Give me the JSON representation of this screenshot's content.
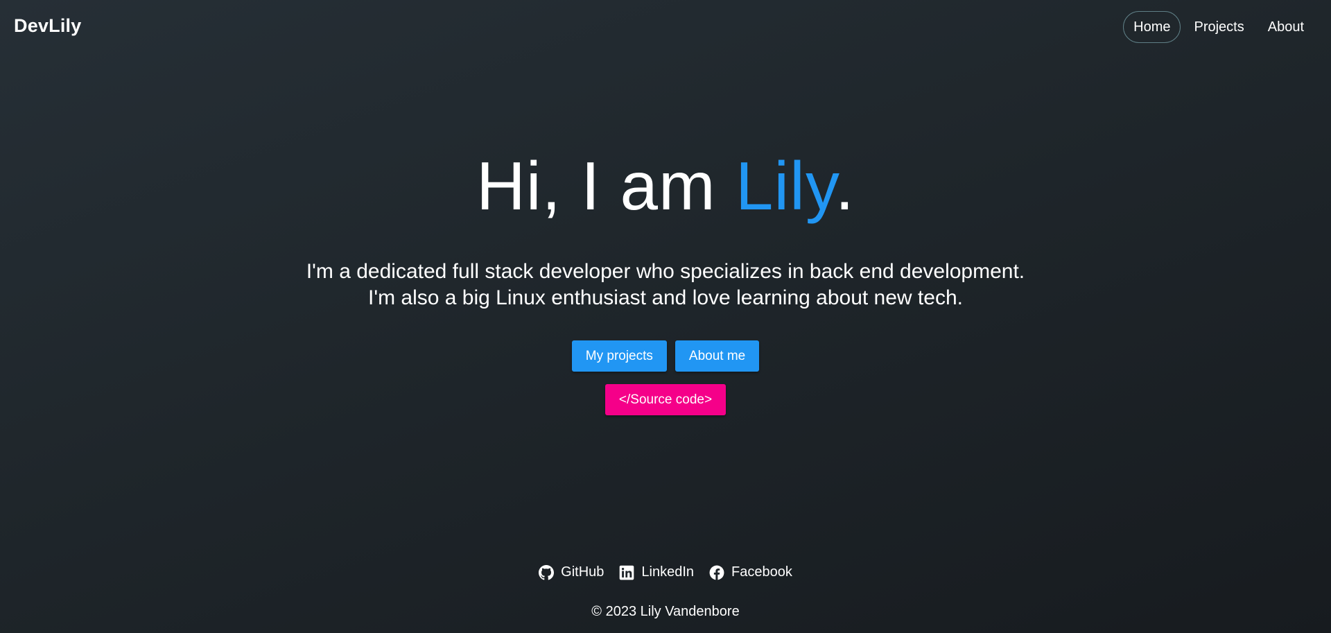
{
  "brand": "DevLily",
  "nav": {
    "home": "Home",
    "projects": "Projects",
    "about": "About"
  },
  "hero": {
    "title_prefix": "Hi, I am ",
    "title_name": "Lily",
    "title_suffix": ".",
    "desc_line1": "I'm a dedicated full stack developer who specializes in back end development.",
    "desc_line2": "I'm also a big Linux enthusiast and love learning about new tech."
  },
  "buttons": {
    "projects": "My projects",
    "about": "About me",
    "source": "</Source code>"
  },
  "socials": {
    "github": "GitHub",
    "linkedin": "LinkedIn",
    "facebook": "Facebook"
  },
  "footer": {
    "copyright": "© 2023 Lily Vandenbore"
  },
  "colors": {
    "accent": "#2196f3",
    "pink": "#f50089",
    "nav_active_border": "#5f7f86"
  },
  "icons": {
    "github": "github-icon",
    "linkedin": "linkedin-icon",
    "facebook": "facebook-icon"
  }
}
